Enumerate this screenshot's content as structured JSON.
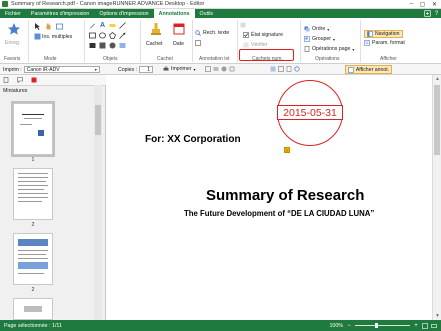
{
  "window": {
    "title": "Summary of Research.pdf - Canon imageRUNNER ADVANCE Desktop - Editor",
    "minimize": "–",
    "maximize": "▢",
    "close": "✕"
  },
  "ribbon_tabs": [
    {
      "label": "Fichier",
      "active": false
    },
    {
      "label": "Paramètres d'impression",
      "active": false
    },
    {
      "label": "Options d'impression",
      "active": false
    },
    {
      "label": "Annotations",
      "active": true
    },
    {
      "label": "Outils",
      "active": false
    }
  ],
  "ribbon": {
    "groups": {
      "favoris": "Favoris",
      "mode": "Mode",
      "objets": "Objets",
      "cachet": "Cachet",
      "annotation_txt": "Annotation txt",
      "cachets_num": "Cachets num.",
      "operations": "Opérations",
      "afficher": "Afficher"
    },
    "enreg_label": "Enreg.",
    "ins_multiples": "Ins. multiples",
    "cachet_label": "Cachet",
    "date_label": "Date",
    "rech_texte": "Rech. texte",
    "etat_signature": "État signature",
    "verifier": "Vérifier",
    "ordre": "Ordre",
    "grouper": "Grouper",
    "operations_page": "Opérations page",
    "navigation": "Navigation",
    "param_format": "Param. format"
  },
  "printbar": {
    "printer_label": "Imprim :",
    "printer_value": "Canon iR-ADV",
    "copies_label": "Copies :",
    "copies_value": "1",
    "print_button": "Imprimer",
    "show_annot_button": "Afficher annot."
  },
  "thumbnails": {
    "pane_title": "Miniatures",
    "pages": [
      {
        "number": "1",
        "selected": true
      },
      {
        "number": "2",
        "selected": false
      },
      {
        "number": "2",
        "selected": false
      }
    ]
  },
  "document": {
    "for_line": "For: XX Corporation",
    "stamp_date": "2015-05-31",
    "heading": "Summary of Research",
    "subheading": "The Future Development of “DE LA CIUDAD LUNA”",
    "note_icon": "note-icon"
  },
  "statusbar": {
    "page_selected": "Page sélectionnée : 1/11",
    "zoom": "100%"
  },
  "colors": {
    "accent": "#1f7a3f",
    "stamp_red": "#d62424",
    "highlight": "#e0201f"
  }
}
